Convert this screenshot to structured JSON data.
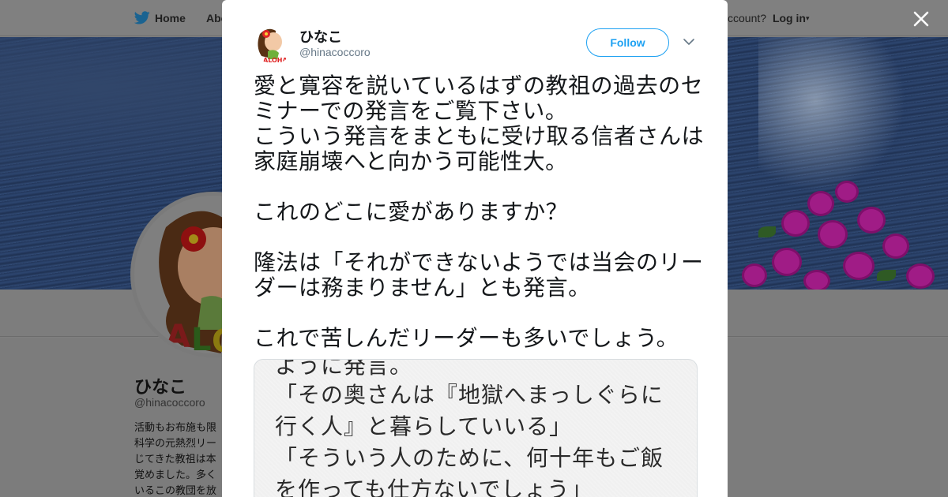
{
  "background_page": {
    "nav": {
      "home_label": "Home",
      "about_label": "Abo",
      "account_prompt": "ccount?",
      "login_label": "Log in",
      "login_caret": "▾"
    },
    "profile": {
      "name": "ひなこ",
      "handle": "@hinacoccoro",
      "bio_lines": [
        "活動もお布施も限",
        "科学の元熱烈リー",
        "じてきた教祖は本",
        "覚めました。多く",
        "いるこの教団を放"
      ]
    }
  },
  "modal": {
    "close_icon": "close-icon",
    "tweet": {
      "author_name": "ひなこ",
      "author_handle": "@hinacoccoro",
      "follow_label": "Follow",
      "menu_icon": "chevron-down-icon",
      "text_lines": [
        "愛と寛容を説いているはずの教祖の過去のセ",
        "ミナーでの発言をご覧下さい。",
        "こういう発言をまともに受け取る信者さんは",
        "家庭崩壊へと向かう可能性大。",
        "",
        "これのどこに愛がありますか？",
        "",
        "隆法は「それができないようでは当会のリー",
        "ダーは務まりません」とも発言。",
        "",
        "これで苦しんだリーダーも多いでしょう。"
      ],
      "media_text_lines": [
        "ように発言。",
        "「その奥さんは『地獄へまっしぐらに",
        "行く人』と暮らしていいる」",
        "「そういう人のために、何十年もご飯",
        "を作っても仕方ないでしょう」"
      ]
    }
  },
  "colors": {
    "accent": "#1da1f2",
    "text_primary": "#14171a",
    "text_secondary": "#657786",
    "overlay": "#7f7f7f"
  }
}
